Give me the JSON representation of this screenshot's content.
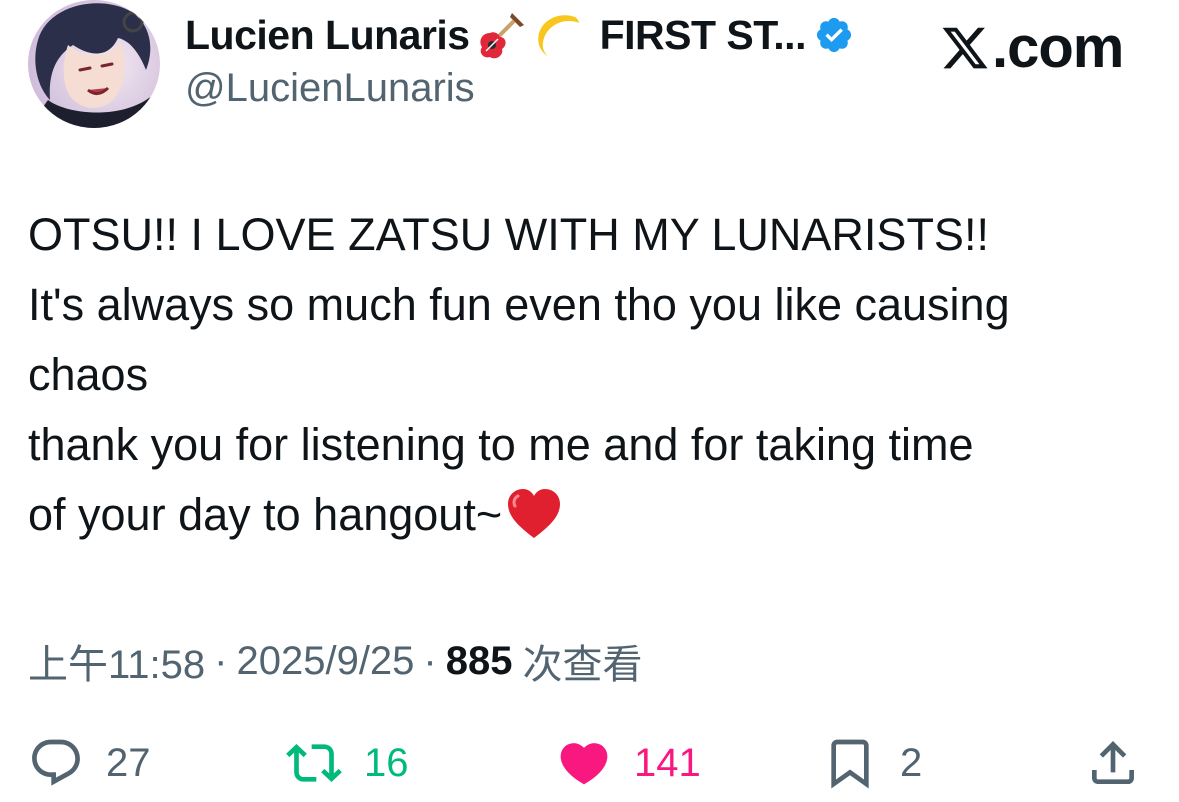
{
  "header": {
    "display_name": "Lucien Lunaris",
    "name_suffix": "FIRST ST...",
    "handle": "@LucienLunaris",
    "brand": ".com",
    "name_emojis": [
      "guitar-emoji",
      "crescent-moon-emoji"
    ],
    "verified_color": "#1d9bf0"
  },
  "tweet": {
    "lines": [
      "OTSU!! I LOVE ZATSU WITH MY LUNARISTS!!",
      "It's always so much fun even tho you like causing",
      "chaos",
      "thank you for listening to me and for taking time",
      "of your day to hangout~"
    ],
    "trailing_emoji": "red-heart-emoji"
  },
  "meta": {
    "time": "上午11:58",
    "date": "2025/9/25",
    "views": "885",
    "views_label": "次查看",
    "separator": "·"
  },
  "actions": {
    "replies": {
      "count": "27",
      "color": "#536471",
      "icon": "reply-icon"
    },
    "reposts": {
      "count": "16",
      "color": "#00ba7c",
      "icon": "repost-icon"
    },
    "likes": {
      "count": "141",
      "color": "#f91880",
      "icon": "heart-filled-icon"
    },
    "bookmarks": {
      "count": "2",
      "color": "#536471",
      "icon": "bookmark-icon"
    },
    "share": {
      "icon": "share-icon",
      "color": "#536471"
    }
  }
}
